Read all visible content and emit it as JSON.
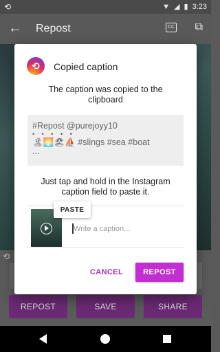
{
  "status_bar": {
    "time": "3:23",
    "left_icon": "repost-sync-icon",
    "wifi_icon": "wifi-icon",
    "signal_icon": "signal-icon",
    "battery_icon": "battery-icon"
  },
  "app_bar": {
    "title": "Repost",
    "back_icon": "back-arrow-icon",
    "caption_icon": "closed-caption-icon",
    "caption_icon_text": "CC",
    "external_icon": "open-external-icon"
  },
  "bottom_actions": {
    "repost": "REPOST",
    "save": "SAVE",
    "share": "SHARE"
  },
  "dialog": {
    "icon": "repost-app-icon",
    "title": "Copied caption",
    "message": "The caption was copied to the clipboard",
    "caption_text": {
      "line1": "#Repost @purejoyy10",
      "line2": "• • • • •",
      "line3": "🏝🌅🏖⛵ #slings #sea #boat",
      "line4": "..."
    },
    "instruction": "Just tap and hold in the Instagram caption field to paste it.",
    "paste_label": "PASTE",
    "caption_placeholder": "Write a caption...",
    "cancel_label": "CANCEL",
    "repost_label": "REPOST"
  },
  "colors": {
    "accent": "#c12fd0",
    "accent_text": "#b42ac6",
    "bg_button": "#6b2a74"
  }
}
